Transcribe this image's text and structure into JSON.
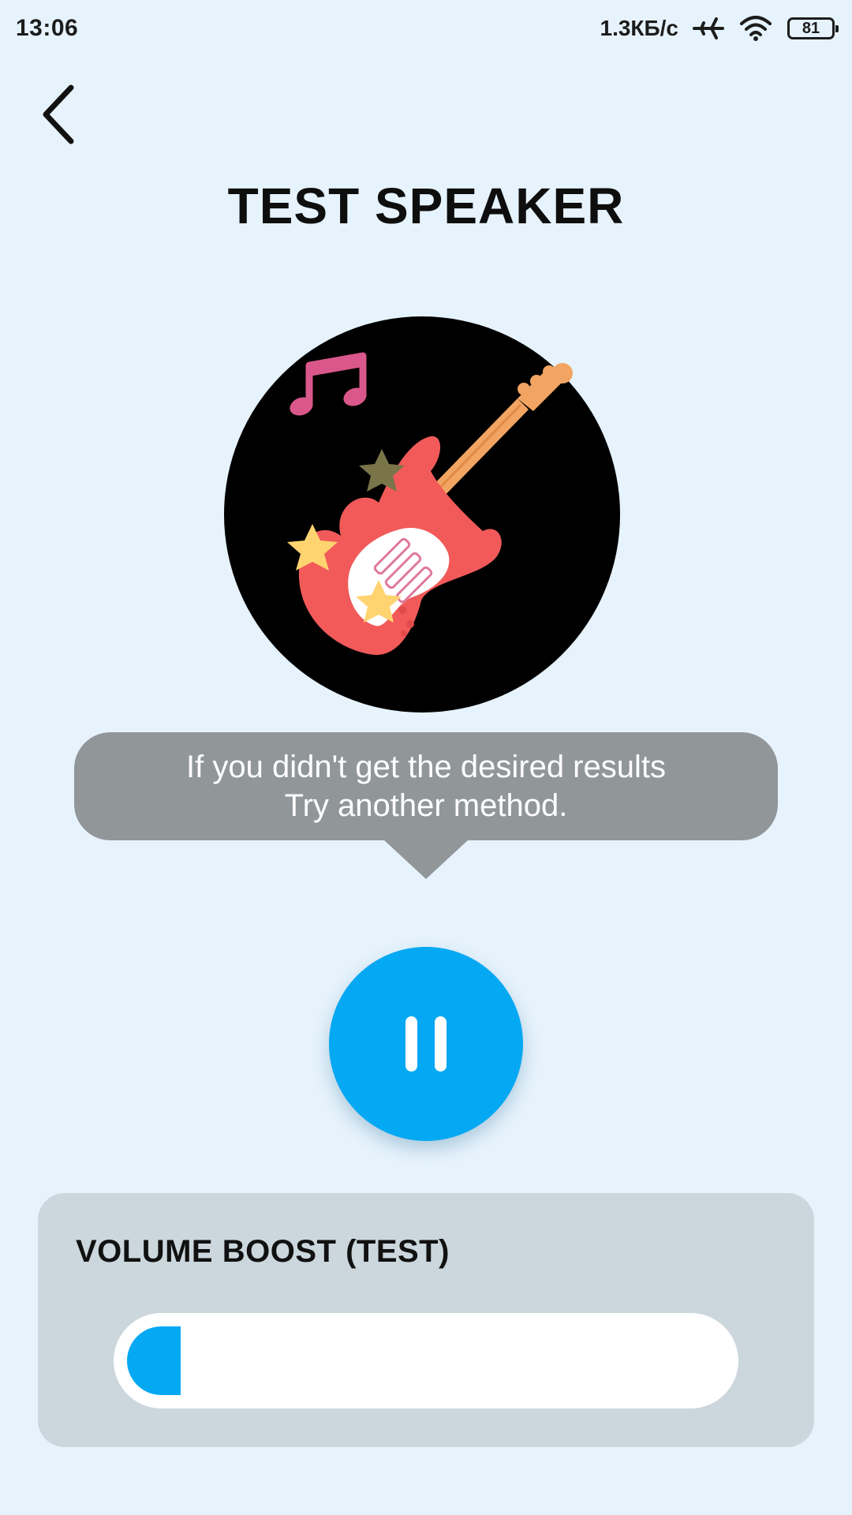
{
  "status_bar": {
    "time": "13:06",
    "speed": "1.3КБ/с",
    "battery": "81",
    "icons": [
      "airplane-icon",
      "wifi-icon",
      "battery-icon"
    ]
  },
  "header": {
    "back_icon": "chevron-left-icon",
    "title": "TEST SPEAKER"
  },
  "artwork": {
    "icons": [
      "music-note-icon",
      "electric-guitar-icon",
      "star-icon"
    ]
  },
  "tooltip": {
    "line1": "If you didn't get the desired results",
    "line2": "Try another method."
  },
  "player": {
    "button_icon": "pause-icon",
    "state": "playing"
  },
  "volume_boost": {
    "title": "VOLUME BOOST (TEST)",
    "level": 0.09
  },
  "colors": {
    "background": "#e6f3fc",
    "accent": "#05a8f2",
    "tooltip": "#919699",
    "panel": "#cbd7dc"
  }
}
